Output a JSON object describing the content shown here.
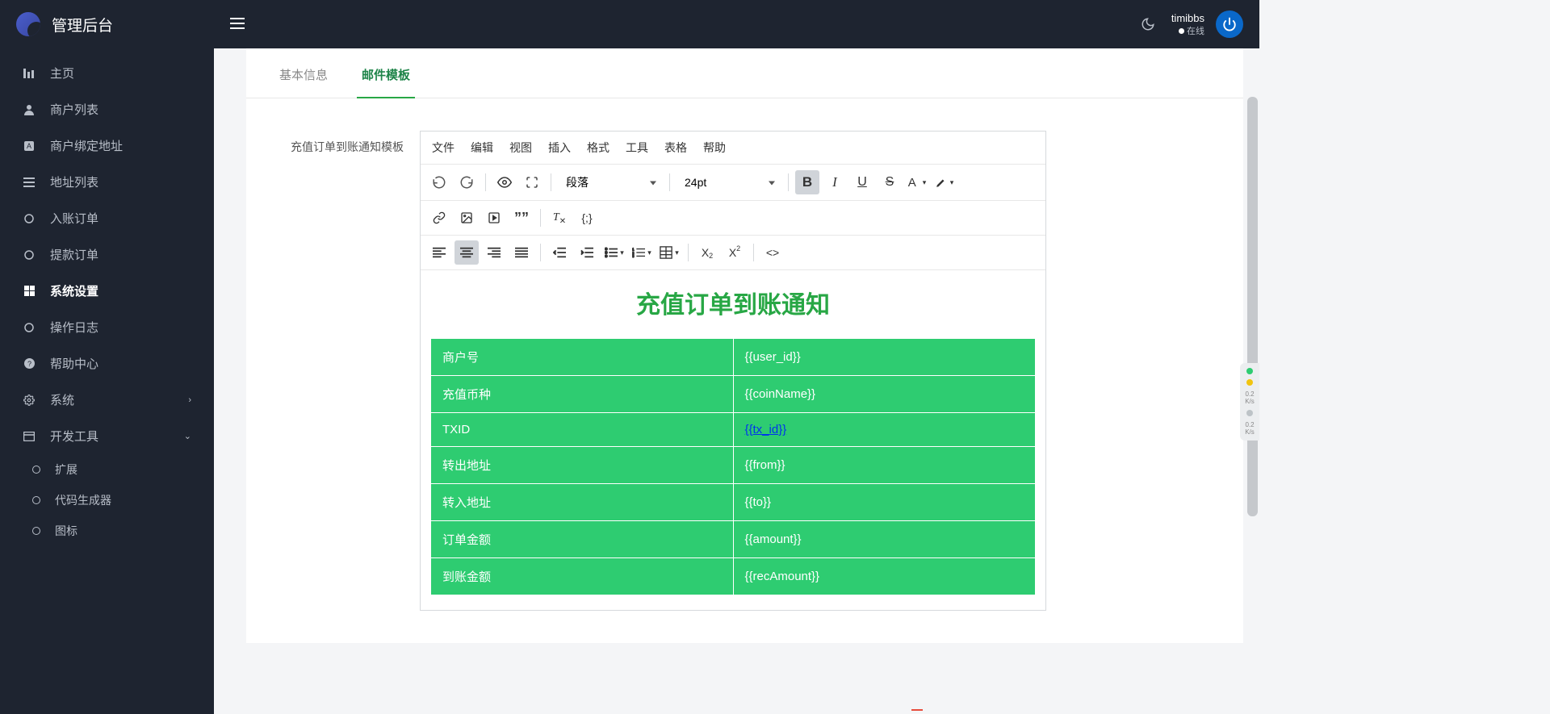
{
  "appTitle": "管理后台",
  "sidebar": {
    "items": [
      {
        "icon": "bars",
        "label": "主页"
      },
      {
        "icon": "user",
        "label": "商户列表"
      },
      {
        "icon": "link",
        "label": "商户绑定地址"
      },
      {
        "icon": "list",
        "label": "地址列表"
      },
      {
        "icon": "circle",
        "label": "入账订单"
      },
      {
        "icon": "circle",
        "label": "提款订单"
      },
      {
        "icon": "windows",
        "label": "系统设置",
        "active": true
      },
      {
        "icon": "circle",
        "label": "操作日志"
      },
      {
        "icon": "help",
        "label": "帮助中心"
      },
      {
        "icon": "gear",
        "label": "系统",
        "chevron": "right"
      },
      {
        "icon": "panel",
        "label": "开发工具",
        "chevron": "down",
        "expanded": true
      }
    ],
    "subitems": [
      {
        "label": "扩展"
      },
      {
        "label": "代码生成器"
      },
      {
        "label": "图标"
      }
    ]
  },
  "user": {
    "name": "timibbs",
    "status": "在线"
  },
  "tabs": [
    {
      "label": "基本信息",
      "active": false
    },
    {
      "label": "邮件模板",
      "active": true
    }
  ],
  "formLabel": "充值订单到账通知模板",
  "editor": {
    "menus": [
      "文件",
      "编辑",
      "视图",
      "插入",
      "格式",
      "工具",
      "表格",
      "帮助"
    ],
    "paragraphSelect": "段落",
    "fontSizeSelect": "24pt",
    "title": "充值订单到账通知",
    "rows": [
      {
        "k": "商户号",
        "v": "{{user_id}}",
        "link": false
      },
      {
        "k": "充值币种",
        "v": "{{coinName}}",
        "link": false
      },
      {
        "k": "TXID",
        "v": "{{tx_id}}",
        "link": true
      },
      {
        "k": "转出地址",
        "v": "{{from}}",
        "link": false
      },
      {
        "k": "转入地址",
        "v": "{{to}}",
        "link": false
      },
      {
        "k": "订单金额",
        "v": "{{amount}}",
        "link": false
      },
      {
        "k": "到账金额",
        "v": "{{recAmount}}",
        "link": false
      }
    ]
  },
  "widget": {
    "up": {
      "val": "0.2",
      "unit": "K/s"
    },
    "down": {
      "val": "0.2",
      "unit": "K/s"
    }
  }
}
